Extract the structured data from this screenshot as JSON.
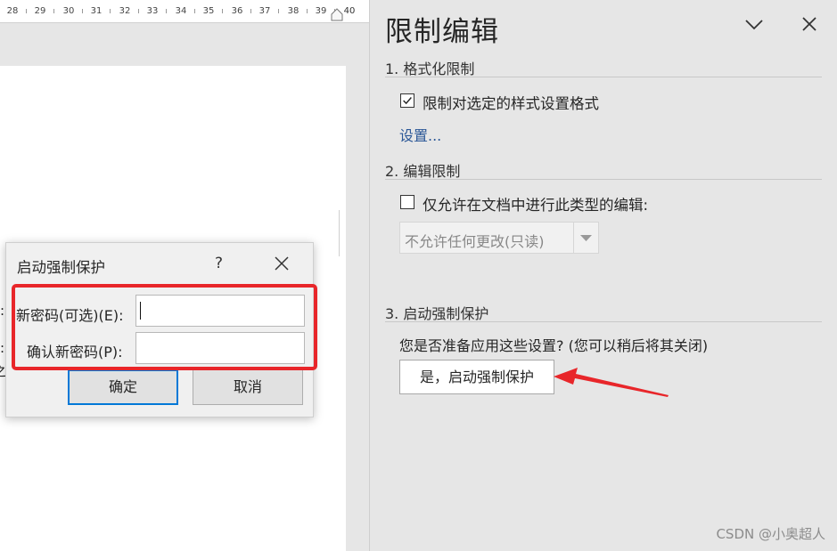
{
  "ruler": {
    "numbers": [
      "28",
      "29",
      "30",
      "31",
      "32",
      "33",
      "34",
      "35",
      "36",
      "37",
      "38",
      "39",
      "40"
    ]
  },
  "document": {
    "fragments": [
      ":",
      ":",
      "之"
    ]
  },
  "pane": {
    "title": "限制编辑",
    "collapse_icon": "chevron-down-icon",
    "close_icon": "close-icon",
    "section1": {
      "heading": "1. 格式化限制",
      "checkbox_label": "限制对选定的样式设置格式",
      "checked": true,
      "link": "设置..."
    },
    "section2": {
      "heading": "2. 编辑限制",
      "checkbox_label": "仅允许在文档中进行此类型的编辑:",
      "checked": false,
      "select_value": "不允许任何更改(只读)"
    },
    "section3": {
      "heading": "3. 启动强制保护",
      "question": "您是否准备应用这些设置? (您可以稍后将其关闭)",
      "button": "是，启动强制保护"
    },
    "watermark": "CSDN @小奥超人"
  },
  "dialog": {
    "title": "启动强制保护",
    "help": "?",
    "new_password_label": "新密码(可选)(E):",
    "confirm_password_label": "确认新密码(P):",
    "new_password_value": "",
    "confirm_password_value": "",
    "ok": "确定",
    "cancel": "取消"
  },
  "colors": {
    "annotation": "#e8262a",
    "link": "#2b5797",
    "focus": "#0078d7"
  }
}
